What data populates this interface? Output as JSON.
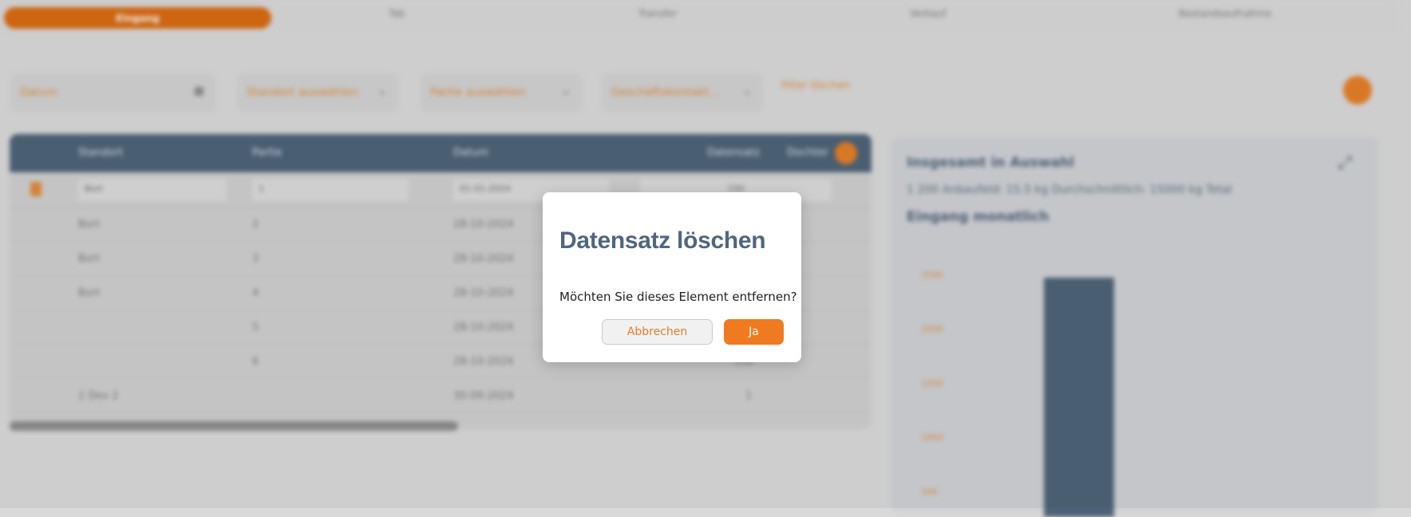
{
  "nav": {
    "tabs": [
      {
        "label": "Eingang",
        "active": true
      },
      {
        "label": "Tab"
      },
      {
        "label": "Transfer"
      },
      {
        "label": "Verkauf"
      },
      {
        "label": "Bestandsaufnahme"
      }
    ]
  },
  "filters": {
    "date": "Datum",
    "supplier": "Standort auswählen",
    "lot": "Partie auswählen",
    "business": "Geschäftskontakt...",
    "reset": "Filter löschen"
  },
  "table": {
    "headers": [
      "Standort",
      "Partie",
      "Datum",
      "Datensatz",
      "Dochter"
    ],
    "filter_row": {
      "standort": "Bort",
      "partie": "1",
      "datum": "01-01-2024",
      "value": "150"
    },
    "rows": [
      {
        "standort": "Bort",
        "partie": "2",
        "datum": "28-10-2024",
        "value": ""
      },
      {
        "standort": "Bort",
        "partie": "3",
        "datum": "28-10-2024",
        "value": ""
      },
      {
        "standort": "Bort",
        "partie": "4",
        "datum": "28-10-2024",
        "value": ""
      },
      {
        "standort": "",
        "partie": "5",
        "datum": "28-10-2024",
        "value": ""
      },
      {
        "standort": "",
        "partie": "6",
        "datum": "28-10-2024",
        "value": "150"
      },
      {
        "standort": "1 Dev 2",
        "partie": "",
        "datum": "30-09-2024",
        "value": "1"
      }
    ]
  },
  "panel": {
    "title": "Insgesamt in Auswahl",
    "subtitle": "1 200 Anbaufeld: 15.5 kg Durchschnittlich: 15000 kg Total",
    "heading": "Eingang monatlich",
    "y_ticks": [
      "2500",
      "2000",
      "1500",
      "1000",
      "500"
    ]
  },
  "dialog": {
    "title": "Datensatz löschen",
    "message": "Möchten Sie dieses Element entfernen?",
    "cancel_label": "Abbrechen",
    "confirm_label": "Ja"
  }
}
